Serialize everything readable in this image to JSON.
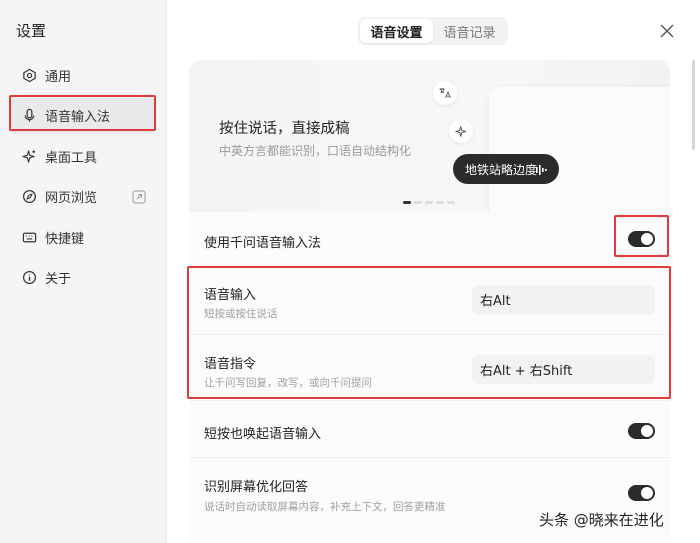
{
  "sidebar": {
    "title": "设置",
    "items": [
      {
        "label": "通用",
        "icon": "hexagon-gear-icon"
      },
      {
        "label": "语音输入法",
        "icon": "microphone-icon",
        "active": true
      },
      {
        "label": "桌面工具",
        "icon": "sparkle-icon"
      },
      {
        "label": "网页浏览",
        "icon": "compass-icon",
        "external": "external-link-icon"
      },
      {
        "label": "快捷键",
        "icon": "keyboard-icon"
      },
      {
        "label": "关于",
        "icon": "info-icon"
      }
    ]
  },
  "tabs": [
    {
      "label": "语音设置",
      "active": true
    },
    {
      "label": "语音记录",
      "active": false
    }
  ],
  "banner": {
    "title": "按住说话，直接成稿",
    "subtitle": "中英方言都能识别，口语自动结构化",
    "pill_text": "地铁站略边度"
  },
  "settings": {
    "enable_label": "使用千问语音输入法",
    "enable_on": true,
    "voice_input": {
      "title": "语音输入",
      "subtitle": "短按或按住说话",
      "key": "右Alt"
    },
    "voice_command": {
      "title": "语音指令",
      "subtitle": "让千问写回复，改写，或向千问提问",
      "key": "右Alt + 右Shift"
    },
    "short_press": {
      "label": "短按也唤起语音输入",
      "on": true
    },
    "screen_recognition": {
      "label": "识别屏幕优化回答",
      "subtitle": "说话时自动读取屏幕内容，补充上下文，回答更精准",
      "on": true
    }
  },
  "watermark": "头条 @晓来在进化",
  "colors": {
    "accent_dark": "#2b2b2d",
    "highlight_red": "#e03a3a",
    "sidebar_bg": "#f5f5f6"
  }
}
